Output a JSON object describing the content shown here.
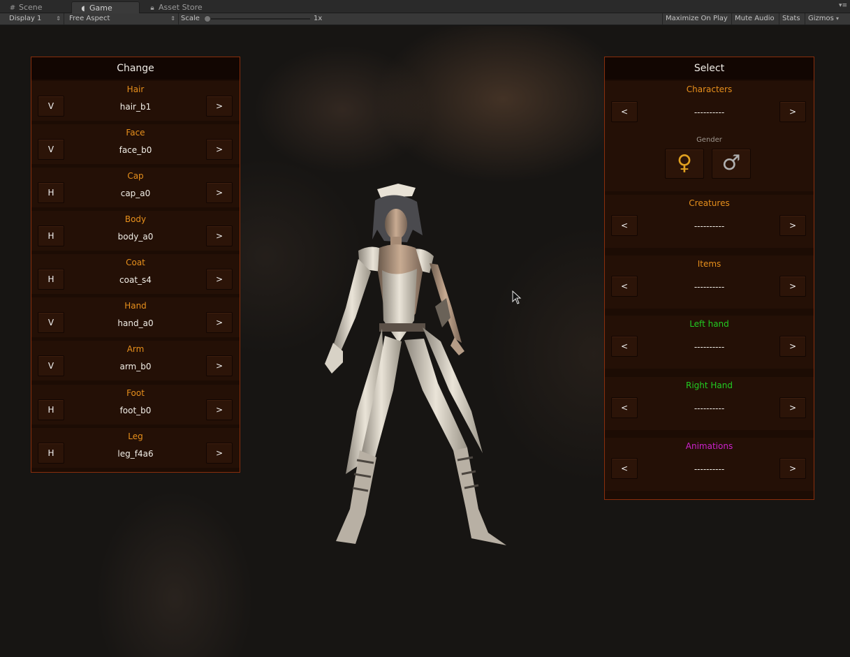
{
  "tabs": [
    {
      "label": "Scene",
      "icon": "grid-icon"
    },
    {
      "label": "Game",
      "icon": "pacman-icon"
    },
    {
      "label": "Asset Store",
      "icon": "lock-icon"
    }
  ],
  "toolbar": {
    "display": "Display 1",
    "aspect": "Free Aspect",
    "scale_label": "Scale",
    "scale_value": "1x",
    "maximize": "Maximize On Play",
    "mute": "Mute Audio",
    "stats": "Stats",
    "gizmos": "Gizmos"
  },
  "change_panel": {
    "title": "Change",
    "rows": [
      {
        "title": "Hair",
        "toggle": "V",
        "value": "hair_b1",
        "next": ">"
      },
      {
        "title": "Face",
        "toggle": "V",
        "value": "face_b0",
        "next": ">"
      },
      {
        "title": "Cap",
        "toggle": "H",
        "value": "cap_a0",
        "next": ">"
      },
      {
        "title": "Body",
        "toggle": "H",
        "value": "body_a0",
        "next": ">"
      },
      {
        "title": "Coat",
        "toggle": "H",
        "value": "coat_s4",
        "next": ">"
      },
      {
        "title": "Hand",
        "toggle": "V",
        "value": "hand_a0",
        "next": ">"
      },
      {
        "title": "Arm",
        "toggle": "V",
        "value": "arm_b0",
        "next": ">"
      },
      {
        "title": "Foot",
        "toggle": "H",
        "value": "foot_b0",
        "next": ">"
      },
      {
        "title": "Leg",
        "toggle": "H",
        "value": "leg_f4a6",
        "next": ">"
      }
    ]
  },
  "select_panel": {
    "title": "Select",
    "characters": {
      "title": "Characters",
      "prev": "<",
      "value": "----------",
      "next": ">"
    },
    "gender": {
      "label": "Gender",
      "female": "♀",
      "male": "♂"
    },
    "creatures": {
      "title": "Creatures",
      "prev": "<",
      "value": "----------",
      "next": ">"
    },
    "items": {
      "title": "Items",
      "prev": "<",
      "value": "----------",
      "next": ">"
    },
    "left_hand": {
      "title": "Left hand",
      "prev": "<",
      "value": "----------",
      "next": ">"
    },
    "right_hand": {
      "title": "Right Hand",
      "prev": "<",
      "value": "----------",
      "next": ">"
    },
    "animations": {
      "title": "Animations",
      "prev": "<",
      "value": "----------",
      "next": ">"
    }
  },
  "colors": {
    "accent_orange": "#e8901c",
    "left_hand_green": "#22cc22",
    "right_hand_green": "#22cc22",
    "animations_magenta": "#cc22cc",
    "female_icon": "#e0a020",
    "male_icon": "#b0b0b0",
    "panel_border": "#8a2e0c"
  }
}
